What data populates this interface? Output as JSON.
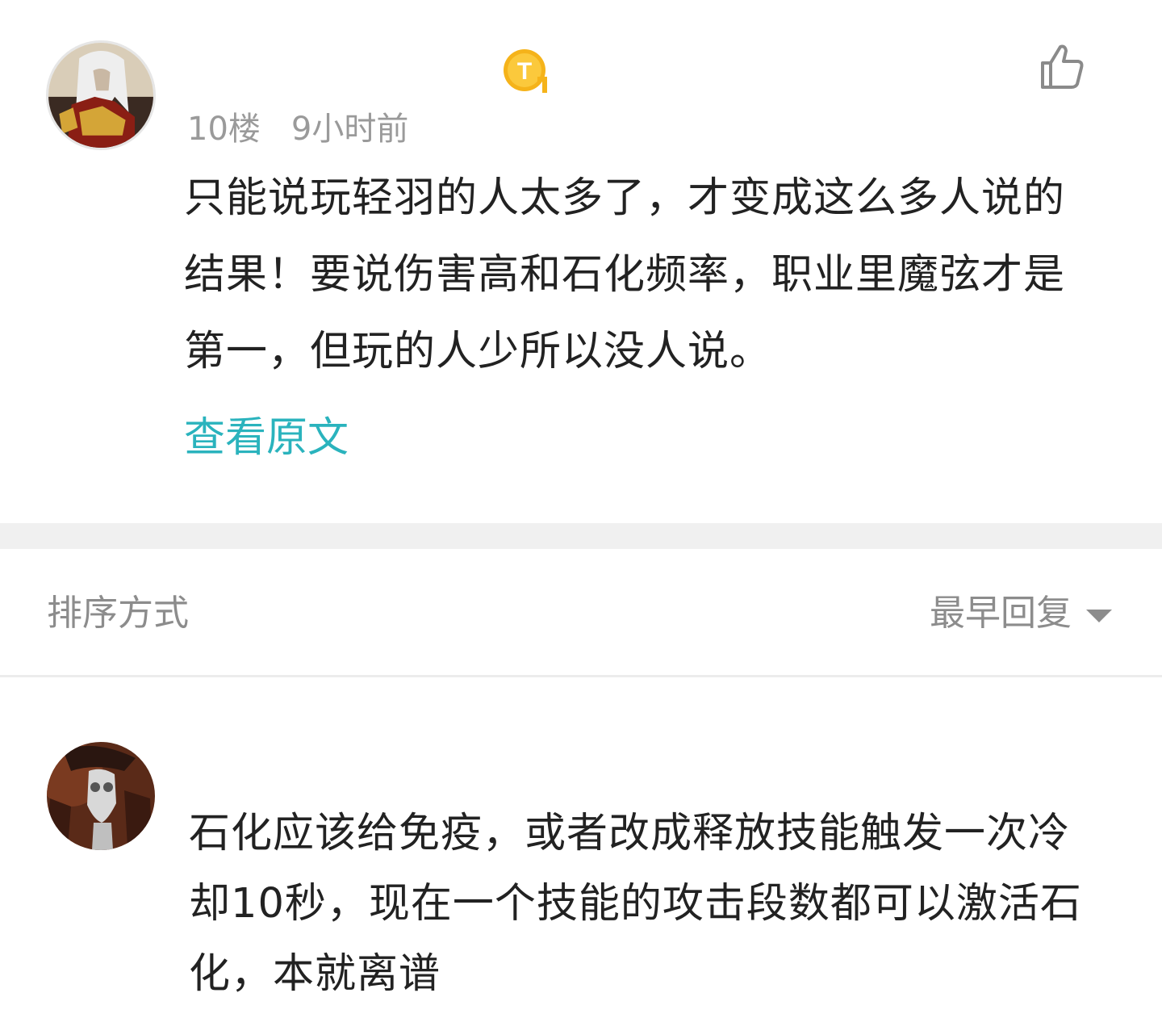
{
  "comments": [
    {
      "floor": "10楼",
      "time": "9小时前",
      "badge_letter": "T",
      "text": "只能说玩轻羽的人太多了，才变成这么多人说的结果！要说伤害高和石化频率，职业里魔弦才是第一，但玩的人少所以没人说。",
      "view_original": "查看原文",
      "icons": {
        "avatar": "avatar",
        "badge": "coin-badge-icon",
        "like": "thumbs-up-icon"
      }
    },
    {
      "text": "石化应该给免疫，或者改成释放技能触发一次冷却10秒，现在一个技能的攻击段数都可以激活石化，本就离谱",
      "icons": {
        "avatar": "avatar"
      }
    }
  ],
  "sort": {
    "label": "排序方式",
    "value": "最早回复"
  },
  "colors": {
    "accent_link": "#2ab3bd",
    "meta_text": "#9a9a9a",
    "body_text": "#222222",
    "divider": "#f0f0f0",
    "coin": "#f5b31a"
  }
}
